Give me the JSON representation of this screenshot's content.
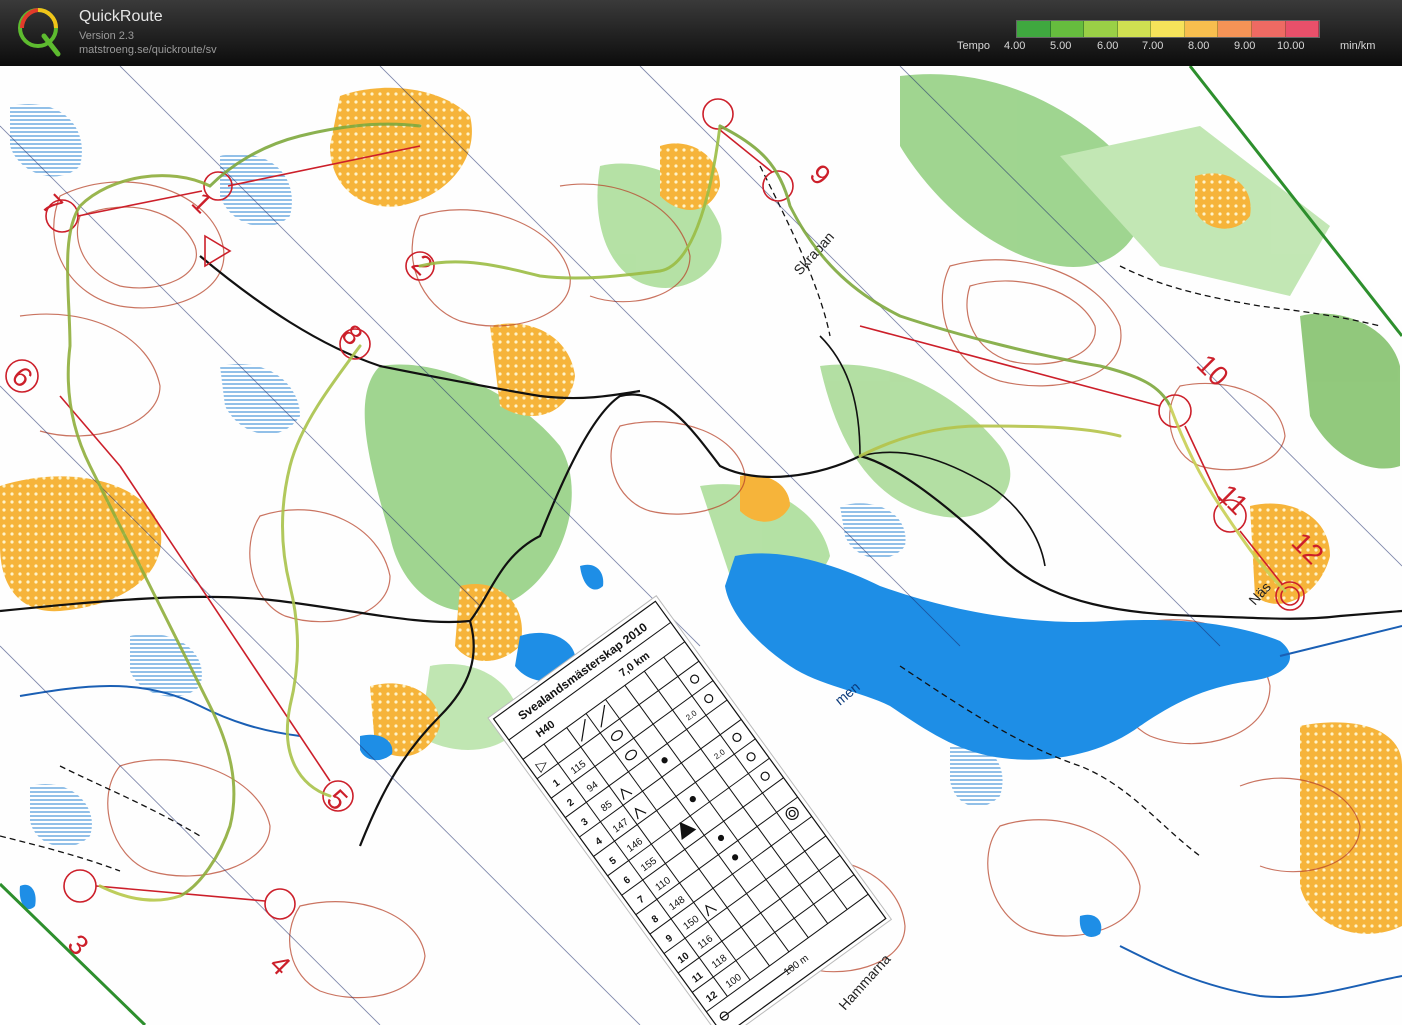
{
  "app": {
    "title": "QuickRoute",
    "version": "Version 2.3",
    "url": "matstroeng.se/quickroute/sv"
  },
  "tempo_legend": {
    "label": "Tempo",
    "ticks": [
      "4.00",
      "5.00",
      "6.00",
      "7.00",
      "8.00",
      "9.00",
      "10.00"
    ],
    "unit": "min/km",
    "colors": [
      "#3fa83f",
      "#66bd3e",
      "#9ad046",
      "#cfe051",
      "#f6e35a",
      "#f7be4e",
      "#f59356",
      "#ee6a63",
      "#e8506a"
    ]
  },
  "map": {
    "control_numbers": [
      "1",
      "2",
      "3",
      "4",
      "5",
      "6",
      "7",
      "8",
      "9",
      "10",
      "11",
      "12"
    ],
    "place_names": [
      "Skrapan",
      "men",
      "Näs",
      "Hammarna"
    ],
    "colors": {
      "lake": "#1e8ee6",
      "open_land": "#f6b43a",
      "forest_green": "#8fce7d",
      "contours": "#b8462c",
      "overprint": "#cc1f2a",
      "route": "#8fae3c"
    }
  },
  "control_card": {
    "event": "Svealandsmästerskap 2010",
    "class": "H40",
    "length": "7,0 km",
    "rows": [
      {
        "num": "1",
        "code": "115"
      },
      {
        "num": "2",
        "code": "94"
      },
      {
        "num": "3",
        "code": "85"
      },
      {
        "num": "4",
        "code": "147"
      },
      {
        "num": "5",
        "code": "146"
      },
      {
        "num": "6",
        "code": "155"
      },
      {
        "num": "7",
        "code": "110"
      },
      {
        "num": "8",
        "code": "148"
      },
      {
        "num": "9",
        "code": "150"
      },
      {
        "num": "10",
        "code": "116"
      },
      {
        "num": "11",
        "code": "118"
      },
      {
        "num": "12",
        "code": "100"
      }
    ],
    "dim_a": "2.0",
    "dim_b": "2.0",
    "finish_distance": "100 m"
  }
}
